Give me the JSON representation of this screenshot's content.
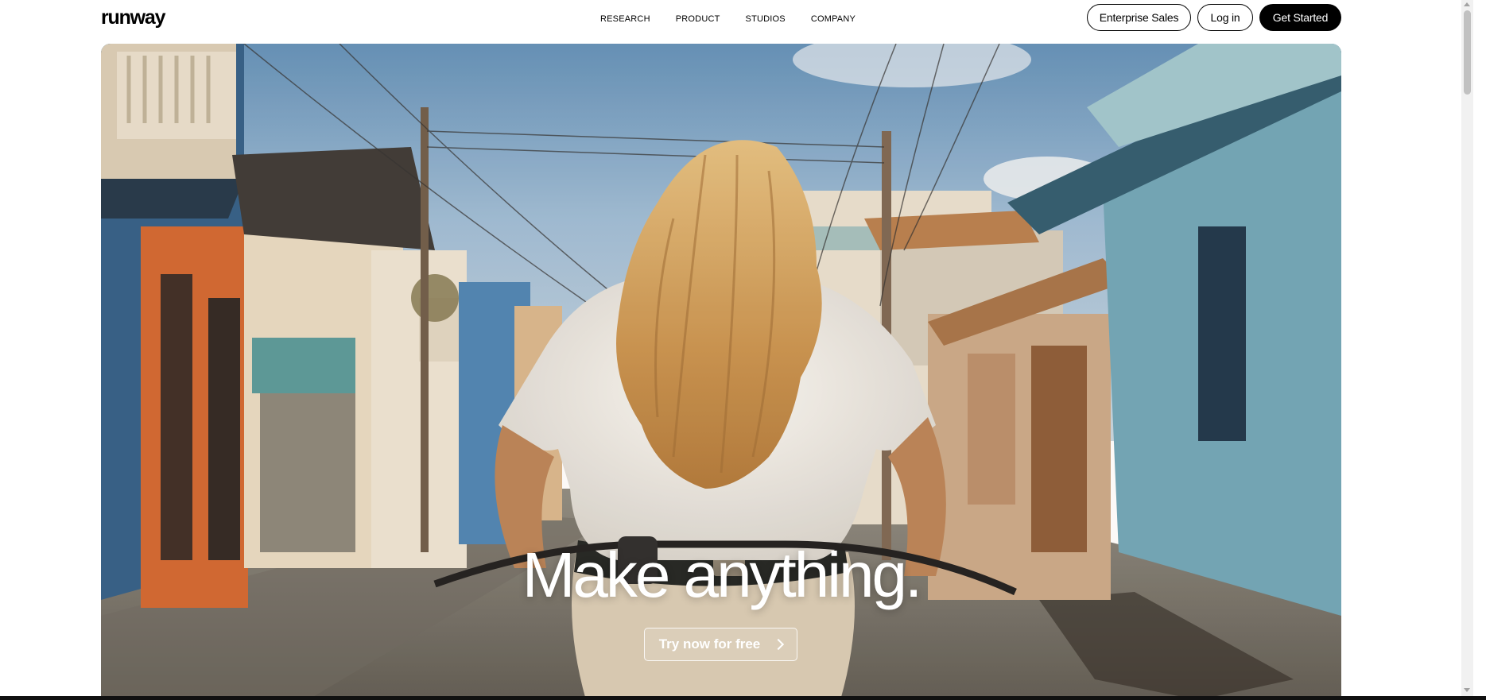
{
  "brand": {
    "logo_text": "runway"
  },
  "nav": {
    "items": [
      "RESEARCH",
      "PRODUCT",
      "STUDIOS",
      "COMPANY"
    ]
  },
  "header_actions": {
    "enterprise_label": "Enterprise Sales",
    "login_label": "Log in",
    "get_started_label": "Get Started"
  },
  "hero": {
    "headline": "Make anything.",
    "cta_label": "Try now for free",
    "cta_icon": "chevron-right-icon"
  },
  "colors": {
    "primary": "#000000",
    "background": "#ffffff",
    "hero_text": "#ffffff"
  }
}
